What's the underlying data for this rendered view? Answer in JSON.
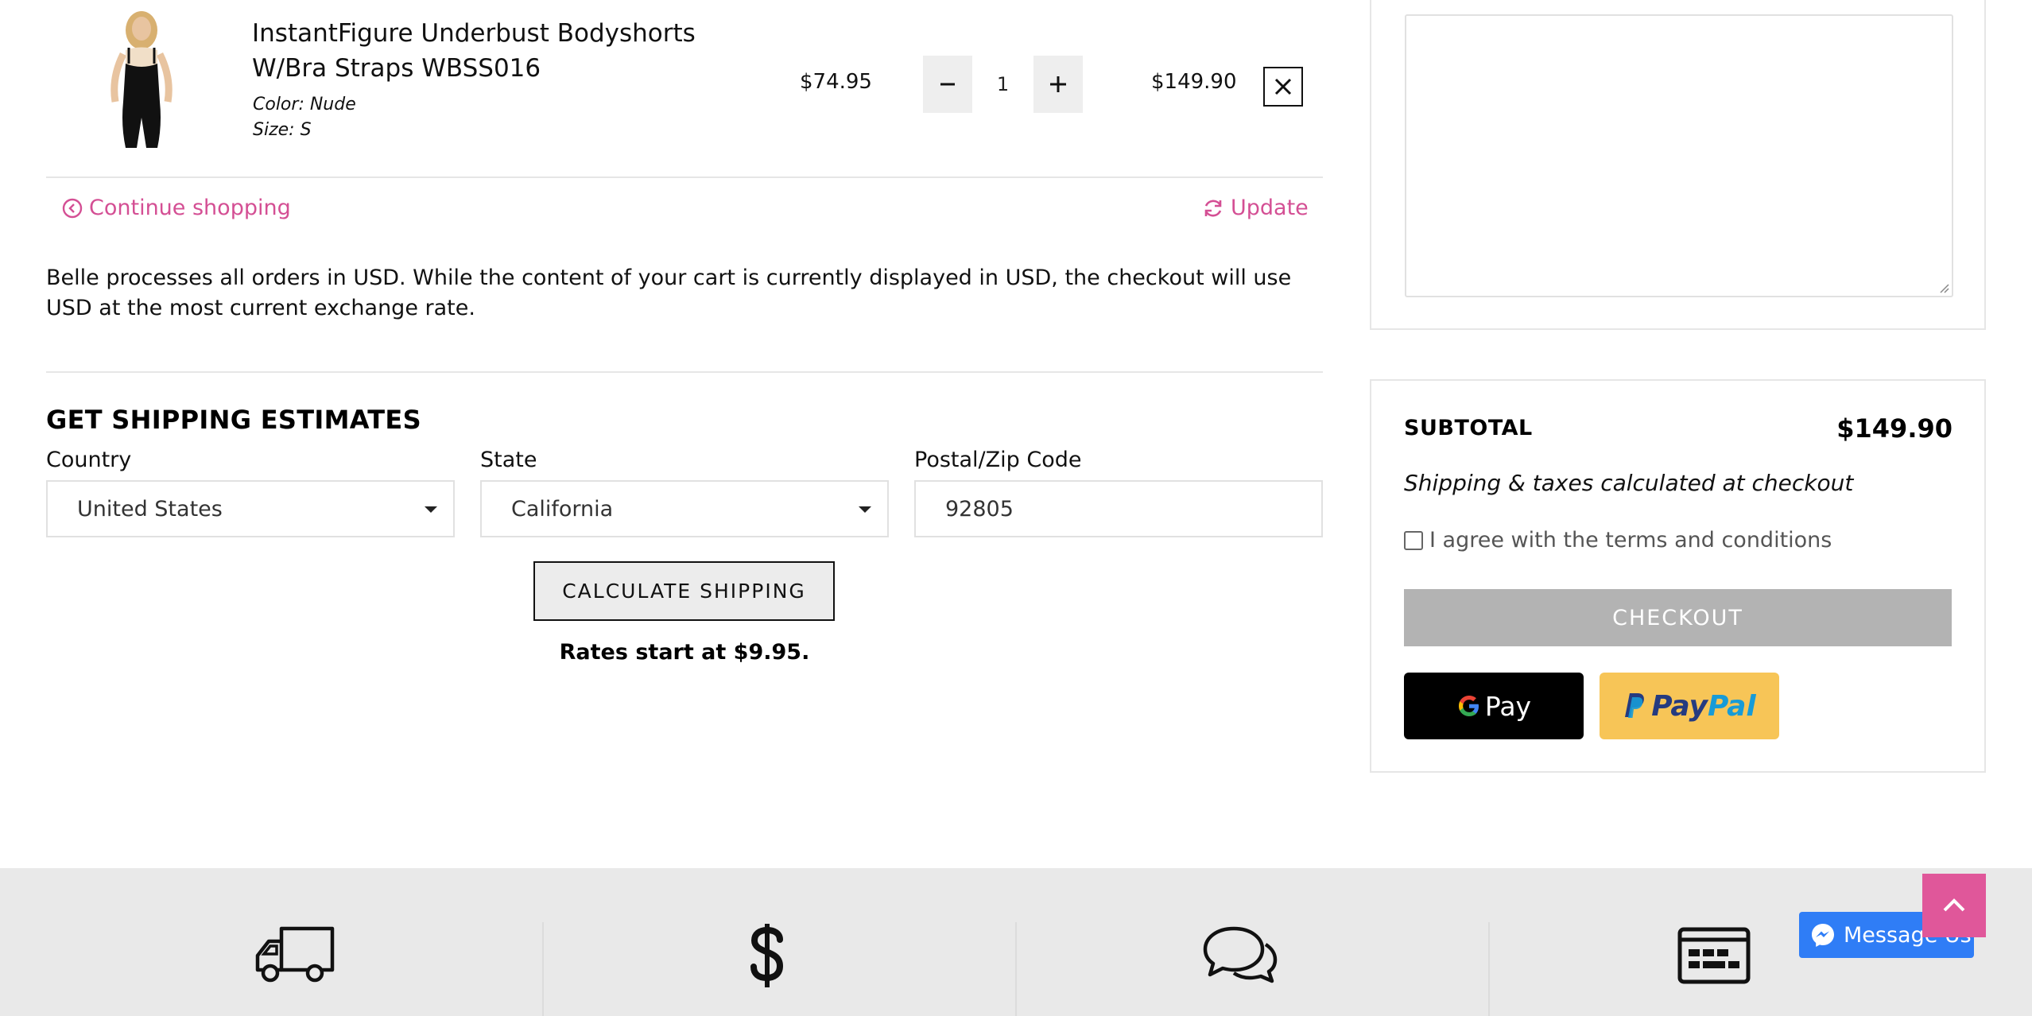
{
  "cart_item": {
    "title": "InstantFigure Underbust Bodyshorts W/Bra Straps WBSS016",
    "color": "Color: Nude",
    "size": "Size: S",
    "unit_price": "$74.95",
    "quantity": "1",
    "line_total": "$149.90"
  },
  "actions": {
    "continue_shopping": "Continue shopping",
    "update": "Update"
  },
  "notice": "Belle processes all orders in USD. While the content of your cart is currently displayed in USD, the checkout will use USD at the most current exchange rate.",
  "shipping": {
    "title": "GET SHIPPING ESTIMATES",
    "country_label": "Country",
    "country_value": "United States",
    "state_label": "State",
    "state_value": "California",
    "zip_label": "Postal/Zip Code",
    "zip_value": "92805",
    "calculate_label": "CALCULATE SHIPPING",
    "rates_text": "Rates start at $9.95."
  },
  "summary": {
    "subtotal_label": "SUBTOTAL",
    "subtotal_value": "$149.90",
    "shipping_note": "Shipping & taxes calculated at checkout",
    "terms_label": "I agree with the terms and conditions",
    "checkout_label": "CHECKOUT",
    "gpay_label": "Pay",
    "paypal_label_1": "Pay",
    "paypal_label_2": "Pal"
  },
  "widgets": {
    "messenger_label": "Message Us"
  },
  "colors": {
    "accent_pink": "#d44f94",
    "checkout_disabled": "#b3b3b3",
    "paypal_yellow": "#f7c557",
    "messenger_blue": "#2f7df6"
  },
  "icons": [
    "close-icon",
    "minus-icon",
    "plus-icon",
    "chevron-left-circle-icon",
    "refresh-icon",
    "caret-down-icon",
    "google-g-icon",
    "paypal-p-icon",
    "truck-icon",
    "dollar-icon",
    "chat-bubbles-icon",
    "id-card-icon",
    "messenger-icon",
    "chevron-up-icon"
  ]
}
